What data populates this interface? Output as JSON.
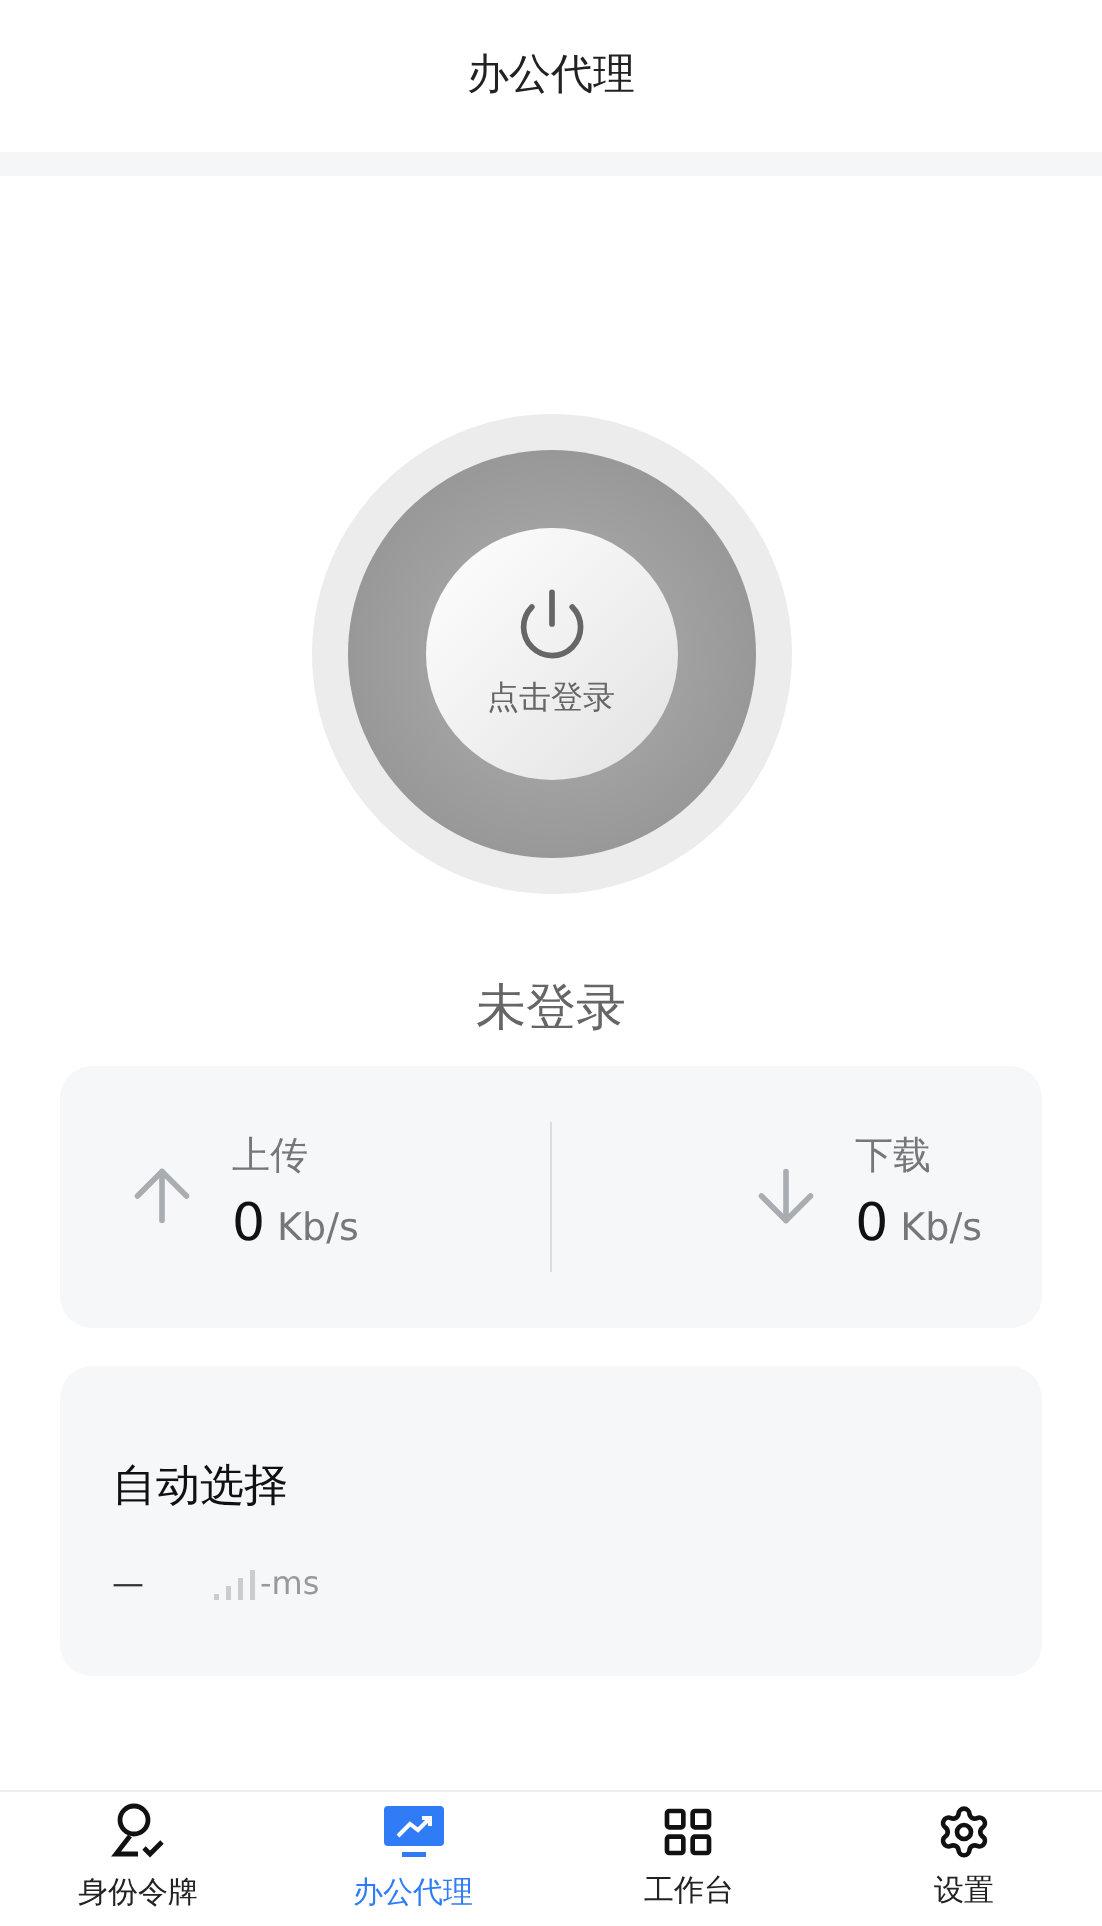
{
  "header": {
    "title": "办公代理"
  },
  "connect_button": {
    "label": "点击登录"
  },
  "status": "未登录",
  "speeds": [
    {
      "kind": "upload",
      "label": "上传",
      "value": "0",
      "unit": "Kb/s"
    },
    {
      "kind": "download",
      "label": "下载",
      "value": "0",
      "unit": "Kb/s"
    }
  ],
  "node": {
    "title": "自动选择",
    "dash": "—",
    "latency": "-ms"
  },
  "tabs": [
    {
      "kind": "identity",
      "label": "身份令牌",
      "selected": false
    },
    {
      "kind": "proxy",
      "label": "办公代理",
      "selected": true
    },
    {
      "kind": "workbench",
      "label": "工作台",
      "selected": false
    },
    {
      "kind": "settings",
      "label": "设置",
      "selected": false
    }
  ]
}
